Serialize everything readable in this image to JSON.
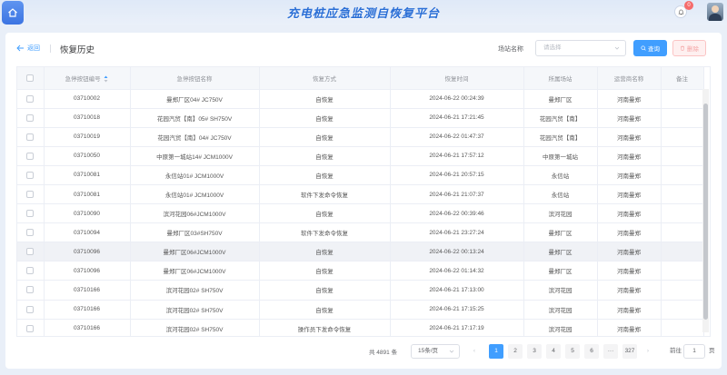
{
  "header": {
    "title": "充电桩应急监测自恢复平台",
    "notification_count": "0"
  },
  "toolbar": {
    "back_label": "返回",
    "page_title": "恢复历史",
    "filter_label": "场站名称",
    "select_placeholder": "请选择",
    "query_label": "查询",
    "delete_label": "删除"
  },
  "table": {
    "columns": [
      "急停按钮编号",
      "急停按钮名称",
      "恢复方式",
      "恢复时间",
      "所属场站",
      "运营商名称",
      "备注"
    ],
    "rows": [
      [
        "03710002",
        "曼郑厂区04# JC750V",
        "自恢复",
        "2024-06-22 00:24:39",
        "曼郑厂区",
        "河南曼郑",
        ""
      ],
      [
        "03710018",
        "花园汽贸【南】05# SH750V",
        "自恢复",
        "2024-06-21 17:21:45",
        "花园汽贸【南】",
        "河南曼郑",
        ""
      ],
      [
        "03710019",
        "花园汽贸【南】04# JC750V",
        "自恢复",
        "2024-06-22 01:47:37",
        "花园汽贸【南】",
        "河南曼郑",
        ""
      ],
      [
        "03710050",
        "中原第一城站14# JCM1000V",
        "自恢复",
        "2024-06-21 17:57:12",
        "中原第一城站",
        "河南曼郑",
        ""
      ],
      [
        "03710081",
        "永信站01# JCM1000V",
        "自恢复",
        "2024-06-21 20:57:15",
        "永信站",
        "河南曼郑",
        ""
      ],
      [
        "03710081",
        "永信站01# JCM1000V",
        "软件下发命令恢复",
        "2024-06-21 21:07:37",
        "永信站",
        "河南曼郑",
        ""
      ],
      [
        "03710090",
        "滨河花园06#JCM1000V",
        "自恢复",
        "2024-06-22 00:39:46",
        "滨河花园",
        "河南曼郑",
        ""
      ],
      [
        "03710094",
        "曼郑厂区03#SH750V",
        "软件下发命令恢复",
        "2024-06-21 23:27:24",
        "曼郑厂区",
        "河南曼郑",
        ""
      ],
      [
        "03710096",
        "曼郑厂区06#JCM1000V",
        "自恢复",
        "2024-06-22 00:13:24",
        "曼郑厂区",
        "河南曼郑",
        ""
      ],
      [
        "03710096",
        "曼郑厂区06#JCM1000V",
        "自恢复",
        "2024-06-22 01:14:32",
        "曼郑厂区",
        "河南曼郑",
        ""
      ],
      [
        "03710166",
        "滨河花园02# SH750V",
        "自恢复",
        "2024-06-21 17:13:00",
        "滨河花园",
        "河南曼郑",
        ""
      ],
      [
        "03710166",
        "滨河花园02# SH750V",
        "自恢复",
        "2024-06-21 17:15:25",
        "滨河花园",
        "河南曼郑",
        ""
      ],
      [
        "03710166",
        "滨河花园02# SH750V",
        "操作员下发命令恢复",
        "2024-06-21 17:17:19",
        "滨河花园",
        "河南曼郑",
        ""
      ]
    ],
    "highlighted_row": 8
  },
  "pagination": {
    "total_label": "共 4891 条",
    "page_size_label": "15条/页",
    "pages": [
      "1",
      "2",
      "3",
      "4",
      "5",
      "6",
      "···",
      "327"
    ],
    "active_page": "1",
    "prev_arrow": "‹",
    "next_arrow": "›",
    "goto_label": "前往",
    "goto_value": "1",
    "goto_suffix": "页"
  },
  "colors": {
    "primary": "#409eff",
    "danger_bg": "#fef0f0",
    "header_bg": "#f5f7fa"
  }
}
